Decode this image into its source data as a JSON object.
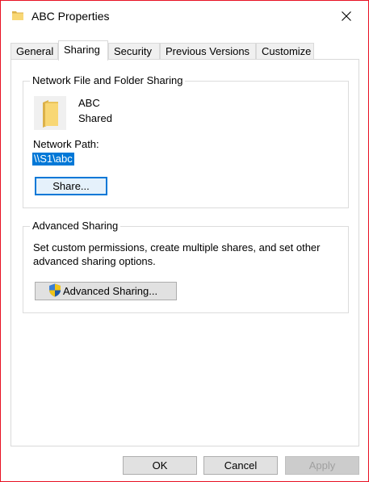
{
  "window": {
    "title": "ABC Properties",
    "icon": "folder-icon",
    "close_icon": "close-icon"
  },
  "tabs": [
    {
      "label": "General",
      "active": false
    },
    {
      "label": "Sharing",
      "active": true
    },
    {
      "label": "Security",
      "active": false
    },
    {
      "label": "Previous Versions",
      "active": false
    },
    {
      "label": "Customize",
      "active": false
    }
  ],
  "network_sharing": {
    "group_title": "Network File and Folder Sharing",
    "folder_name": "ABC",
    "status": "Shared",
    "network_path_label": "Network Path:",
    "network_path": "\\\\S1\\abc",
    "share_button": "Share..."
  },
  "advanced_sharing": {
    "group_title": "Advanced Sharing",
    "description": "Set custom permissions, create multiple shares, and set other advanced sharing options.",
    "button_label": "Advanced Sharing...",
    "button_icon": "uac-shield-icon"
  },
  "footer": {
    "ok": "OK",
    "cancel": "Cancel",
    "apply": "Apply"
  },
  "colors": {
    "accent": "#0078d7",
    "window_border": "#e81123",
    "folder_yellow": "#f8d775"
  }
}
